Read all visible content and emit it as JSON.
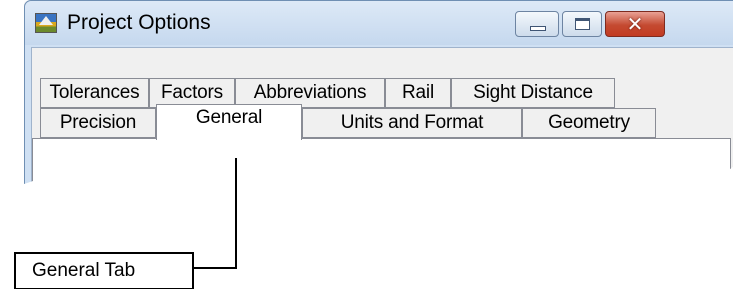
{
  "window": {
    "title": "Project Options",
    "controls": {
      "minimize": "minimize-icon",
      "maximize": "maximize-icon",
      "close": "close-icon",
      "close_glyph": "✕"
    }
  },
  "tabs": {
    "row1": [
      "Tolerances",
      "Factors",
      "Abbreviations",
      "Rail",
      "Sight Distance"
    ],
    "row2": [
      "Precision",
      "General",
      "Units and Format",
      "Geometry"
    ],
    "selected": "General"
  },
  "callout": {
    "label": "General Tab"
  },
  "colors": {
    "titlebar": "#c5d8ee",
    "close_button": "#c44a31",
    "tab_face": "#f0f0f0",
    "active_tab": "#ffffff"
  }
}
